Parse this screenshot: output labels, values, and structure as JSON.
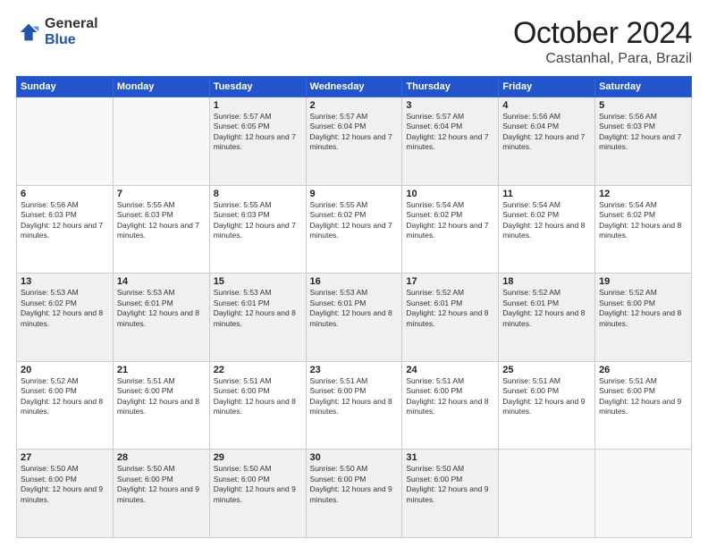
{
  "logo": {
    "general": "General",
    "blue": "Blue"
  },
  "header": {
    "month": "October 2024",
    "location": "Castanhal, Para, Brazil"
  },
  "weekdays": [
    "Sunday",
    "Monday",
    "Tuesday",
    "Wednesday",
    "Thursday",
    "Friday",
    "Saturday"
  ],
  "weeks": [
    [
      {
        "day": "",
        "info": ""
      },
      {
        "day": "",
        "info": ""
      },
      {
        "day": "1",
        "info": "Sunrise: 5:57 AM\nSunset: 6:05 PM\nDaylight: 12 hours and 7 minutes."
      },
      {
        "day": "2",
        "info": "Sunrise: 5:57 AM\nSunset: 6:04 PM\nDaylight: 12 hours and 7 minutes."
      },
      {
        "day": "3",
        "info": "Sunrise: 5:57 AM\nSunset: 6:04 PM\nDaylight: 12 hours and 7 minutes."
      },
      {
        "day": "4",
        "info": "Sunrise: 5:56 AM\nSunset: 6:04 PM\nDaylight: 12 hours and 7 minutes."
      },
      {
        "day": "5",
        "info": "Sunrise: 5:56 AM\nSunset: 6:03 PM\nDaylight: 12 hours and 7 minutes."
      }
    ],
    [
      {
        "day": "6",
        "info": "Sunrise: 5:56 AM\nSunset: 6:03 PM\nDaylight: 12 hours and 7 minutes."
      },
      {
        "day": "7",
        "info": "Sunrise: 5:55 AM\nSunset: 6:03 PM\nDaylight: 12 hours and 7 minutes."
      },
      {
        "day": "8",
        "info": "Sunrise: 5:55 AM\nSunset: 6:03 PM\nDaylight: 12 hours and 7 minutes."
      },
      {
        "day": "9",
        "info": "Sunrise: 5:55 AM\nSunset: 6:02 PM\nDaylight: 12 hours and 7 minutes."
      },
      {
        "day": "10",
        "info": "Sunrise: 5:54 AM\nSunset: 6:02 PM\nDaylight: 12 hours and 7 minutes."
      },
      {
        "day": "11",
        "info": "Sunrise: 5:54 AM\nSunset: 6:02 PM\nDaylight: 12 hours and 8 minutes."
      },
      {
        "day": "12",
        "info": "Sunrise: 5:54 AM\nSunset: 6:02 PM\nDaylight: 12 hours and 8 minutes."
      }
    ],
    [
      {
        "day": "13",
        "info": "Sunrise: 5:53 AM\nSunset: 6:02 PM\nDaylight: 12 hours and 8 minutes."
      },
      {
        "day": "14",
        "info": "Sunrise: 5:53 AM\nSunset: 6:01 PM\nDaylight: 12 hours and 8 minutes."
      },
      {
        "day": "15",
        "info": "Sunrise: 5:53 AM\nSunset: 6:01 PM\nDaylight: 12 hours and 8 minutes."
      },
      {
        "day": "16",
        "info": "Sunrise: 5:53 AM\nSunset: 6:01 PM\nDaylight: 12 hours and 8 minutes."
      },
      {
        "day": "17",
        "info": "Sunrise: 5:52 AM\nSunset: 6:01 PM\nDaylight: 12 hours and 8 minutes."
      },
      {
        "day": "18",
        "info": "Sunrise: 5:52 AM\nSunset: 6:01 PM\nDaylight: 12 hours and 8 minutes."
      },
      {
        "day": "19",
        "info": "Sunrise: 5:52 AM\nSunset: 6:00 PM\nDaylight: 12 hours and 8 minutes."
      }
    ],
    [
      {
        "day": "20",
        "info": "Sunrise: 5:52 AM\nSunset: 6:00 PM\nDaylight: 12 hours and 8 minutes."
      },
      {
        "day": "21",
        "info": "Sunrise: 5:51 AM\nSunset: 6:00 PM\nDaylight: 12 hours and 8 minutes."
      },
      {
        "day": "22",
        "info": "Sunrise: 5:51 AM\nSunset: 6:00 PM\nDaylight: 12 hours and 8 minutes."
      },
      {
        "day": "23",
        "info": "Sunrise: 5:51 AM\nSunset: 6:00 PM\nDaylight: 12 hours and 8 minutes."
      },
      {
        "day": "24",
        "info": "Sunrise: 5:51 AM\nSunset: 6:00 PM\nDaylight: 12 hours and 8 minutes."
      },
      {
        "day": "25",
        "info": "Sunrise: 5:51 AM\nSunset: 6:00 PM\nDaylight: 12 hours and 9 minutes."
      },
      {
        "day": "26",
        "info": "Sunrise: 5:51 AM\nSunset: 6:00 PM\nDaylight: 12 hours and 9 minutes."
      }
    ],
    [
      {
        "day": "27",
        "info": "Sunrise: 5:50 AM\nSunset: 6:00 PM\nDaylight: 12 hours and 9 minutes."
      },
      {
        "day": "28",
        "info": "Sunrise: 5:50 AM\nSunset: 6:00 PM\nDaylight: 12 hours and 9 minutes."
      },
      {
        "day": "29",
        "info": "Sunrise: 5:50 AM\nSunset: 6:00 PM\nDaylight: 12 hours and 9 minutes."
      },
      {
        "day": "30",
        "info": "Sunrise: 5:50 AM\nSunset: 6:00 PM\nDaylight: 12 hours and 9 minutes."
      },
      {
        "day": "31",
        "info": "Sunrise: 5:50 AM\nSunset: 6:00 PM\nDaylight: 12 hours and 9 minutes."
      },
      {
        "day": "",
        "info": ""
      },
      {
        "day": "",
        "info": ""
      }
    ]
  ]
}
